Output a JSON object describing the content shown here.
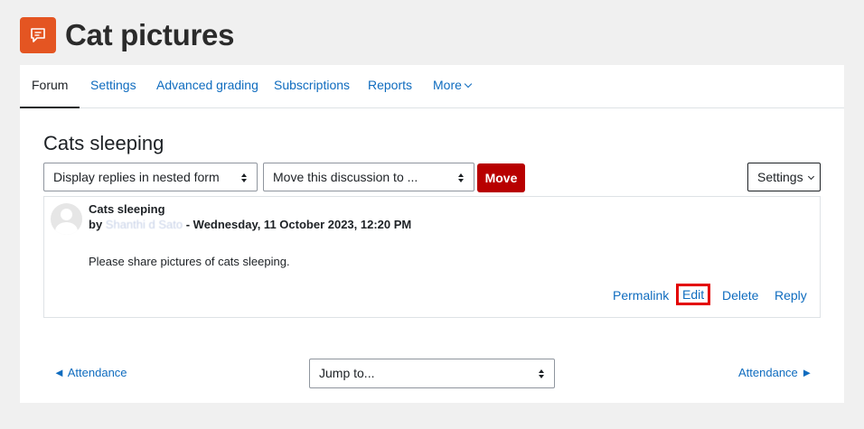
{
  "header": {
    "title": "Cat pictures",
    "icon": "forum-icon",
    "icon_color": "#e45522"
  },
  "tabs": [
    {
      "label": "Forum",
      "active": true
    },
    {
      "label": "Settings"
    },
    {
      "label": "Advanced grading"
    },
    {
      "label": "Subscriptions"
    },
    {
      "label": "Reports"
    },
    {
      "label": "More"
    }
  ],
  "discussion": {
    "title": "Cats sleeping",
    "display_mode": "Display replies in nested form",
    "move_select": "Move this discussion to ...",
    "move_button": "Move",
    "settings_button": "Settings"
  },
  "post": {
    "subject": "Cats sleeping",
    "by": "by",
    "author": "Shanthi d Sato",
    "date": "- Wednesday, 11 October 2023, 12:20 PM",
    "body": "Please share pictures of cats sleeping.",
    "actions": {
      "permalink": "Permalink",
      "edit": "Edit",
      "delete": "Delete",
      "reply": "Reply"
    }
  },
  "footer_nav": {
    "prev": "◄ Attendance",
    "jump": "Jump to...",
    "next": "Attendance ►"
  },
  "colors": {
    "link": "#0f6cbf",
    "danger": "#b80000",
    "highlight": "#e30000"
  }
}
